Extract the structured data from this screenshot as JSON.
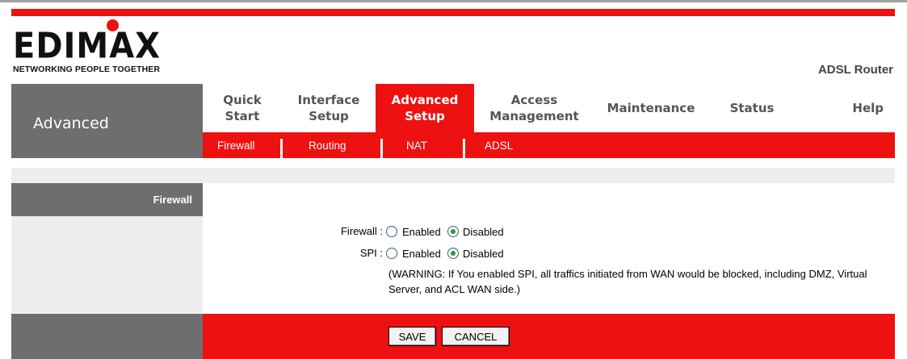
{
  "brand": {
    "logo_text": "EDIMAX",
    "tagline": "NETWORKING PEOPLE TOGETHER",
    "product": "ADSL Router"
  },
  "sidebar": {
    "title": "Advanced"
  },
  "menu": {
    "items": [
      {
        "label": "Quick\nStart"
      },
      {
        "label": "Interface\nSetup"
      },
      {
        "label": "Advanced\nSetup"
      },
      {
        "label": "Access\nManagement"
      },
      {
        "label": "Maintenance"
      },
      {
        "label": "Status"
      },
      {
        "label": "Help"
      }
    ],
    "active_index": 2
  },
  "submenu": {
    "items": [
      {
        "label": "Firewall"
      },
      {
        "label": "Routing"
      },
      {
        "label": "NAT"
      },
      {
        "label": "ADSL"
      }
    ]
  },
  "section": {
    "title": "Firewall"
  },
  "form": {
    "firewall": {
      "label": "Firewall :",
      "options": [
        "Enabled",
        "Disabled"
      ],
      "selected": "Disabled"
    },
    "spi": {
      "label": "SPI :",
      "options": [
        "Enabled",
        "Disabled"
      ],
      "selected": "Disabled"
    },
    "warning": "(WARNING: If You enabled SPI, all traffics initiated from WAN would be blocked, including DMZ, Virtual Server, and ACL WAN side.)"
  },
  "buttons": {
    "save": "SAVE",
    "cancel": "CANCEL"
  },
  "colors": {
    "accent": "#ee1111",
    "panel_gray": "#6e6e6e",
    "light_gray": "#eeeeee"
  }
}
